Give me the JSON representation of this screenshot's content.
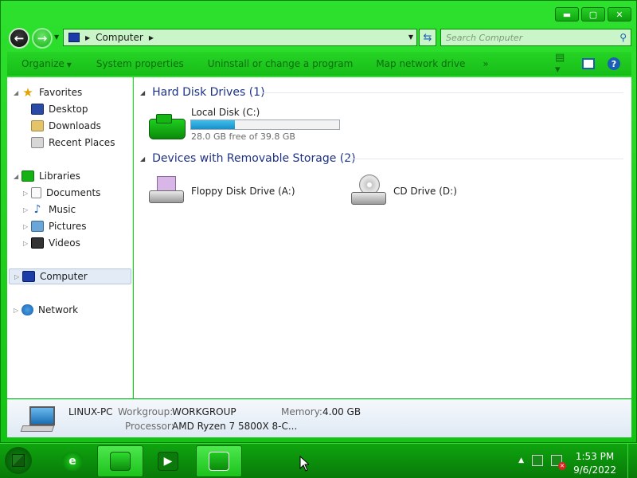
{
  "window": {
    "caption_min": "▬",
    "caption_max": "▢",
    "caption_close": "✕"
  },
  "address": {
    "location": "Computer",
    "search_placeholder": "Search Computer"
  },
  "commands": {
    "organize": "Organize",
    "system_properties": "System properties",
    "uninstall": "Uninstall or change a program",
    "map_drive": "Map network drive",
    "more": "»"
  },
  "navpane": {
    "favorites": "Favorites",
    "desktop": "Desktop",
    "downloads": "Downloads",
    "recent_places": "Recent Places",
    "libraries": "Libraries",
    "documents": "Documents",
    "music": "Music",
    "pictures": "Pictures",
    "videos": "Videos",
    "computer": "Computer",
    "network": "Network"
  },
  "content": {
    "hdd_header": "Hard Disk Drives (1)",
    "local_disk": {
      "name": "Local Disk (C:)",
      "free": "28.0 GB free of 39.8 GB",
      "used_fraction": 0.296
    },
    "removable_header": "Devices with Removable Storage (2)",
    "floppy": "Floppy Disk Drive (A:)",
    "cd": "CD Drive (D:)"
  },
  "details": {
    "computer_name": "LINUX-PC",
    "workgroup_label": "Workgroup:",
    "workgroup": "WORKGROUP",
    "memory_label": "Memory:",
    "memory": "4.00 GB",
    "processor_label": "Processor:",
    "processor": "AMD Ryzen 7 5800X 8-C..."
  },
  "taskbar": {
    "time": "1:53 PM",
    "date": "9/6/2022",
    "tray_expand": "▲"
  },
  "icons": {
    "ie": "e",
    "media": "▶",
    "help": "?"
  }
}
